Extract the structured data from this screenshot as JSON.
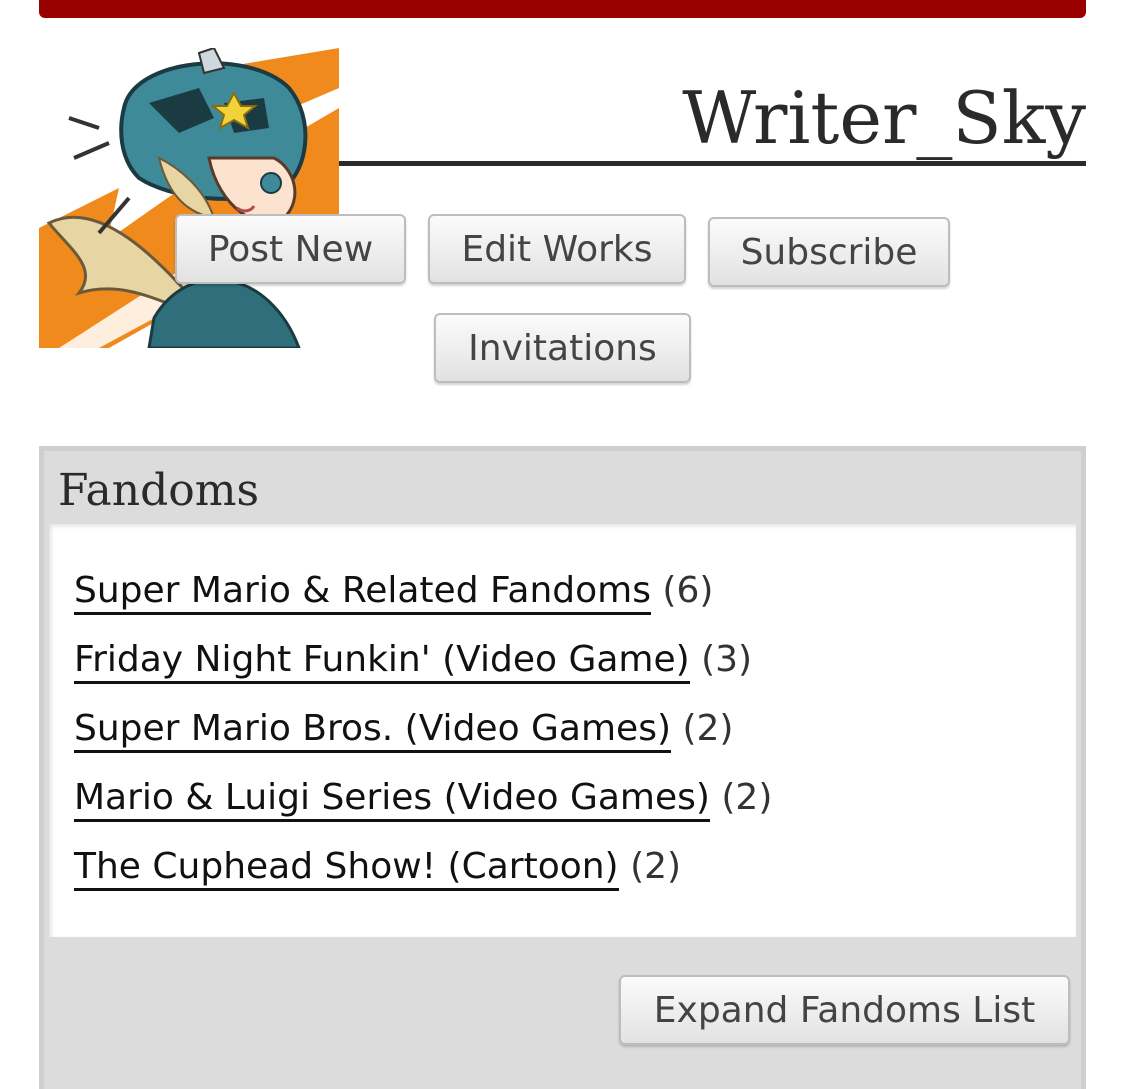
{
  "profile": {
    "username": "Writer_Sky",
    "avatar_icon": "profile-avatar-image"
  },
  "actions": {
    "post_new": "Post New",
    "edit_works": "Edit Works",
    "subscribe": "Subscribe",
    "invitations": "Invitations"
  },
  "fandoms": {
    "title": "Fandoms",
    "items": [
      {
        "name": "Super Mario & Related Fandoms",
        "count": "(6)"
      },
      {
        "name": "Friday Night Funkin' (Video Game)",
        "count": "(3)"
      },
      {
        "name": "Super Mario Bros. (Video Games)",
        "count": "(2)"
      },
      {
        "name": "Mario & Luigi Series (Video Games)",
        "count": "(2)"
      },
      {
        "name": "The Cuphead Show! (Cartoon)",
        "count": "(2)"
      }
    ],
    "expand_label": "Expand Fandoms List"
  },
  "colors": {
    "header_bar": "#990000",
    "avatar_orange": "#f08a1c",
    "armor_teal": "#3f8a99",
    "hair_blond": "#e8d5a4"
  }
}
